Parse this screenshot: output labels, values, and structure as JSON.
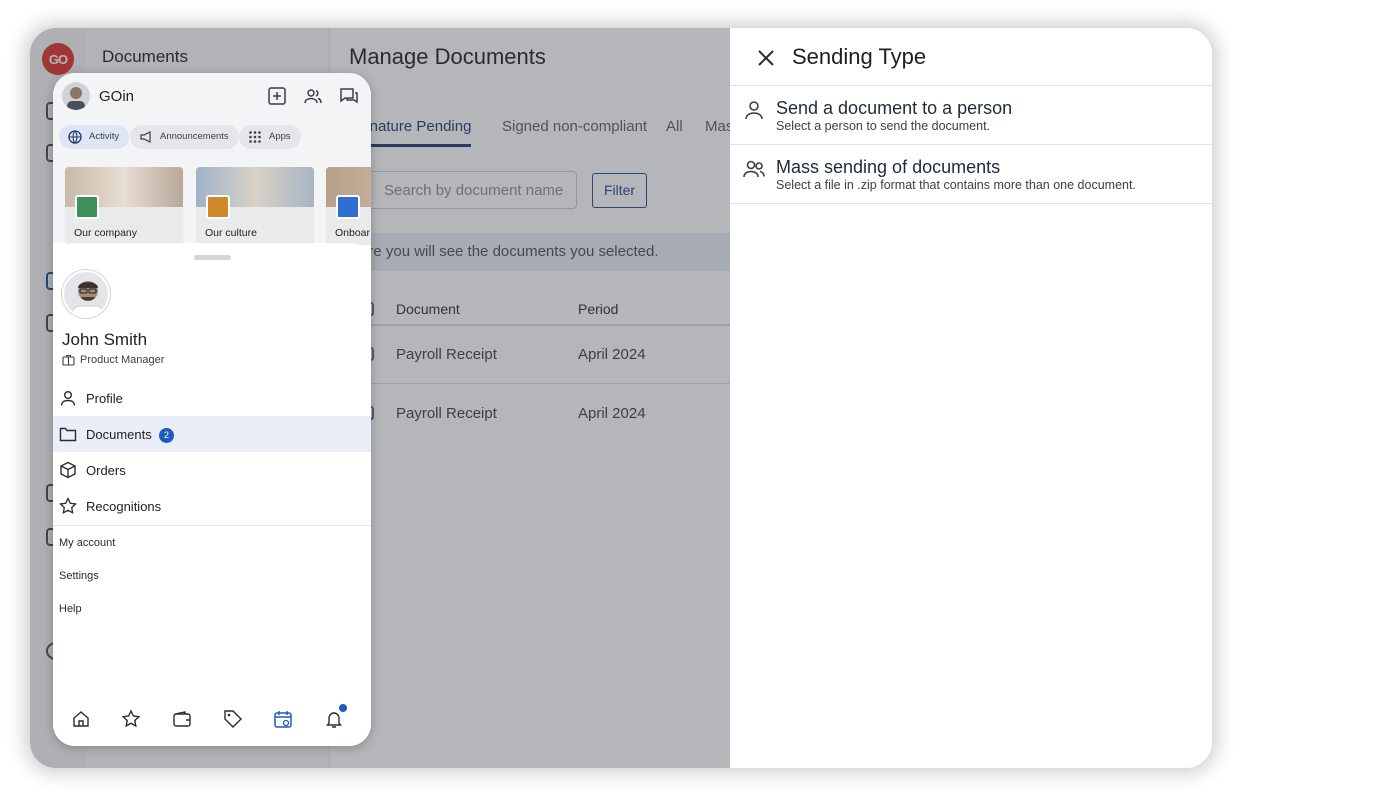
{
  "app": {
    "logo_text": "GO",
    "section_title": "Documents"
  },
  "main": {
    "title": "Manage Documents",
    "tabs": [
      "ignature Pending",
      "Signed non-compliant",
      "All",
      "Mas"
    ],
    "search_placeholder": "Search by document name",
    "filter_label": "Filter",
    "info_text": "ere you will see the documents you selected.",
    "columns": [
      "Document",
      "Period"
    ],
    "rows": [
      {
        "document": "Payroll Receipt",
        "period": "April 2024"
      },
      {
        "document": "Payroll Receipt",
        "period": "April 2024"
      }
    ]
  },
  "panel": {
    "title": "Sending Type",
    "options": [
      {
        "title": "Send a document to a person",
        "subtitle": "Select a person to send the document.",
        "icon": "person-icon"
      },
      {
        "title": "Mass sending of documents",
        "subtitle": "Select a file in .zip format that contains more than one document.",
        "icon": "people-icon"
      }
    ]
  },
  "phone": {
    "app_name": "GOin",
    "chips": [
      "Activity",
      "Announcements",
      "Apps"
    ],
    "cards": [
      "Our company",
      "Our culture",
      "Onboar"
    ],
    "user": {
      "name": "John Smith",
      "role": "Product Manager"
    },
    "menu": [
      {
        "label": "Profile",
        "icon": "person-icon"
      },
      {
        "label": "Documents",
        "icon": "folder-icon",
        "badge": "2"
      },
      {
        "label": "Orders",
        "icon": "box-icon"
      },
      {
        "label": "Recognitions",
        "icon": "star-icon"
      }
    ],
    "secondary": [
      "My account",
      "Settings",
      "Help"
    ],
    "bottom_nav": [
      "home-icon",
      "star-icon",
      "wallet-icon",
      "tag-icon",
      "calendar-icon",
      "bell-icon"
    ]
  },
  "colors": {
    "accent": "#1e4a9a",
    "brand": "#e0312a",
    "badge": "#1e5bbf"
  }
}
